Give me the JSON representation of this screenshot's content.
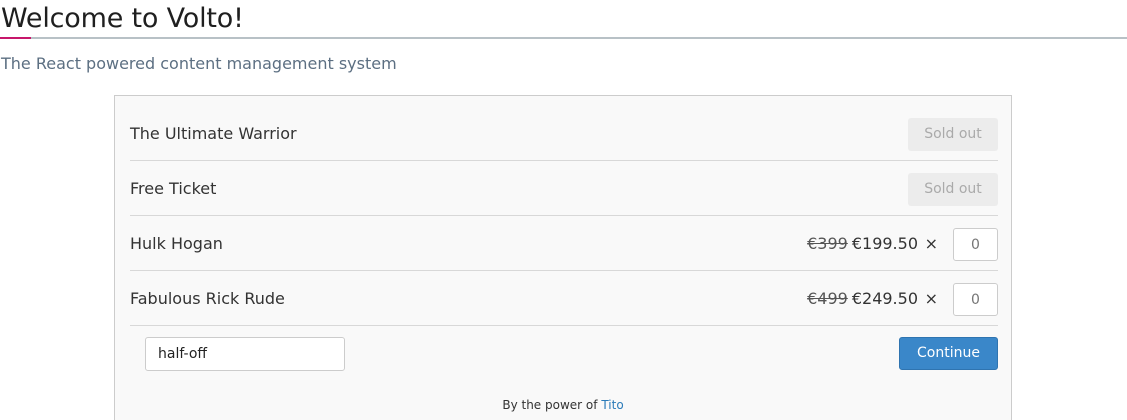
{
  "page": {
    "title": "Welcome to Volto!",
    "subtitle": "The React powered content management system",
    "colors": {
      "accent": "#c7166b",
      "continue_button": "#3a87c9",
      "link": "#2b7bb9"
    }
  },
  "tito": {
    "tickets": [
      {
        "name": "The Ultimate Warrior",
        "status": "Sold out"
      },
      {
        "name": "Free Ticket",
        "status": "Sold out"
      },
      {
        "name": "Hulk Hogan",
        "old_price": "€399",
        "price": "€199.50",
        "times": "×",
        "quantity": "0"
      },
      {
        "name": "Fabulous Rick Rude",
        "old_price": "€499",
        "price": "€249.50",
        "times": "×",
        "quantity": "0"
      }
    ],
    "discount_code": "half-off",
    "continue_label": "Continue",
    "powered_by_prefix": "By the power of",
    "powered_by_link": "Tito"
  }
}
